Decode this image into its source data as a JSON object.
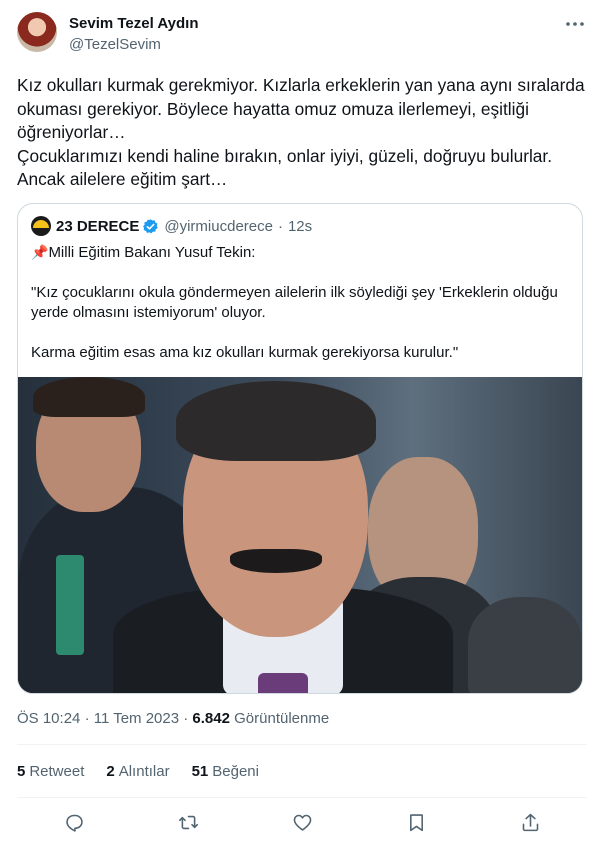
{
  "author": {
    "name": "Sevim Tezel Aydın",
    "handle": "@TezelSevim"
  },
  "tweet": {
    "text": "Kız okulları kurmak gerekmiyor. Kızlarla erkeklerin yan yana aynı sıralarda okuması gerekiyor. Böylece hayatta omuz omuza ilerlemeyi, eşitliği öğreniyorlar…\nÇocuklarımızı kendi haline bırakın, onlar iyiyi, güzeli, doğruyu bulurlar.\nAncak ailelere eğitim şart…"
  },
  "quote": {
    "name": "23 DERECE",
    "handle": "@yirmiucderece",
    "separator": "·",
    "time": "12s",
    "pin_icon": "📌",
    "intro": "Milli Eğitim Bakanı Yusuf Tekin:",
    "body": "\"Kız çocuklarını okula göndermeyen ailelerin ilk söylediği şey 'Erkeklerin olduğu yerde olmasını istemiyorum' oluyor.\n\nKarma eğitim esas ama kız okulları kurmak gerekiyorsa kurulur.\""
  },
  "meta": {
    "time": "ÖS 10:24",
    "dot": "·",
    "date": "11 Tem 2023",
    "views_count": "6.842",
    "views_label": "Görüntülenme"
  },
  "stats": {
    "retweets_count": "5",
    "retweets_label": "Retweet",
    "quotes_count": "2",
    "quotes_label": "Alıntılar",
    "likes_count": "51",
    "likes_label": "Beğeni"
  },
  "icons": {
    "more": "more-dots-icon",
    "verified": "verified-badge-icon",
    "reply": "reply-icon",
    "retweet": "retweet-icon",
    "like": "heart-icon",
    "bookmark": "bookmark-icon",
    "share": "share-icon"
  },
  "colors": {
    "text": "#0f1419",
    "secondary": "#536471",
    "border": "#cfd9de",
    "verified": "#1d9bf0"
  }
}
